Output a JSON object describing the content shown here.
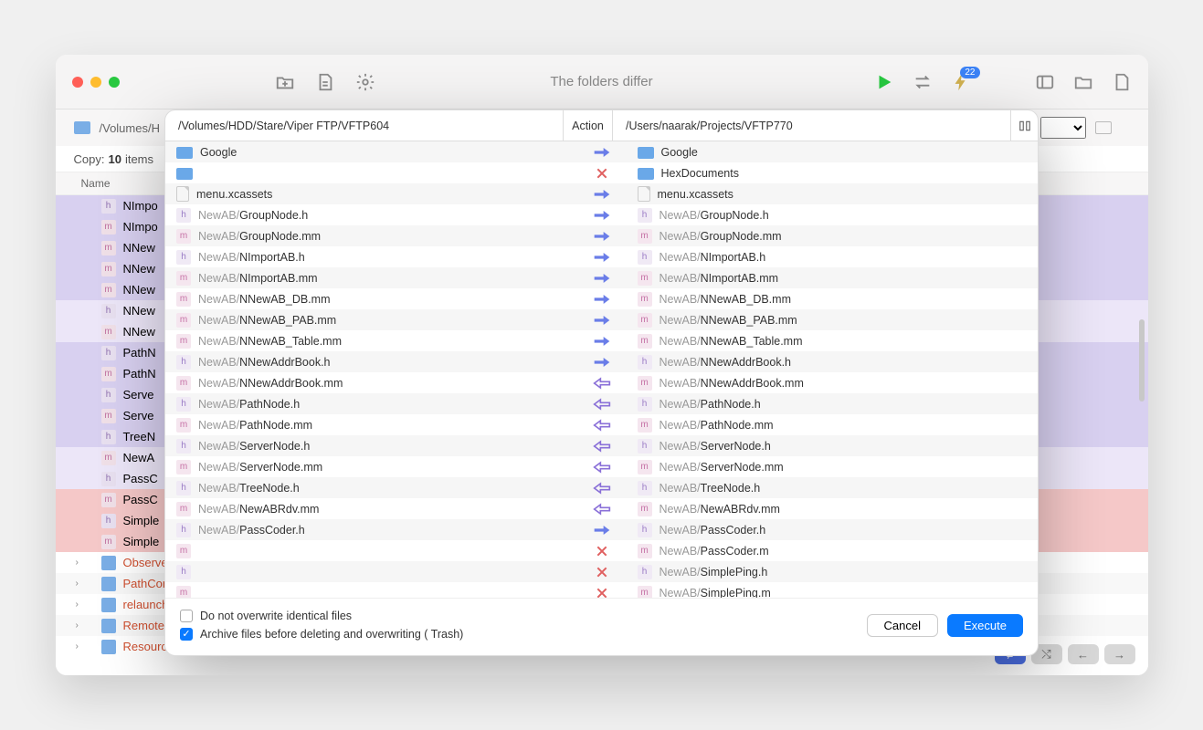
{
  "toolbar": {
    "title": "The folders differ",
    "badge": "22"
  },
  "bg": {
    "path": "/Volumes/H",
    "copy_prefix": "Copy:",
    "copy_count": "10",
    "copy_suffix": "items",
    "column_name": "Name",
    "rows": [
      {
        "icon": "h",
        "name": "NImpo",
        "cls": "row-purple"
      },
      {
        "icon": "m",
        "name": "NImpo",
        "cls": "row-purple"
      },
      {
        "icon": "m",
        "name": "NNew",
        "cls": "row-purple"
      },
      {
        "icon": "m",
        "name": "NNew",
        "cls": "row-purple"
      },
      {
        "icon": "m",
        "name": "NNew",
        "cls": "row-purple"
      },
      {
        "icon": "h",
        "name": "NNew",
        "cls": "row-lightpurple"
      },
      {
        "icon": "m",
        "name": "NNew",
        "cls": "row-lightpurple"
      },
      {
        "icon": "h",
        "name": "PathN",
        "cls": "row-purple"
      },
      {
        "icon": "m",
        "name": "PathN",
        "cls": "row-purple"
      },
      {
        "icon": "h",
        "name": "Serve",
        "cls": "row-purple"
      },
      {
        "icon": "m",
        "name": "Serve",
        "cls": "row-purple"
      },
      {
        "icon": "h",
        "name": "TreeN",
        "cls": "row-purple"
      },
      {
        "icon": "m",
        "name": "NewA",
        "cls": "row-lightpurple"
      },
      {
        "icon": "h",
        "name": "PassC",
        "cls": "row-lightpurple"
      },
      {
        "icon": "m",
        "name": "PassC",
        "cls": "row-pink"
      },
      {
        "icon": "h",
        "name": "Simple",
        "cls": "row-pink"
      },
      {
        "icon": "m",
        "name": "Simple",
        "cls": "row-pink"
      },
      {
        "icon": "folder",
        "name": "Observe",
        "cls": "",
        "red": true,
        "arrow": true
      },
      {
        "icon": "folder",
        "name": "PathCon",
        "cls": "row-lighter",
        "red": true,
        "arrow": true
      },
      {
        "icon": "folder",
        "name": "relaunch",
        "cls": "",
        "red": true,
        "arrow": true
      },
      {
        "icon": "folder",
        "name": "RemoteF",
        "cls": "row-lighter",
        "red": true,
        "arrow": true
      },
      {
        "icon": "folder",
        "name": "Resource",
        "cls": "",
        "red": true,
        "arrow": true
      }
    ]
  },
  "modal": {
    "left_path": "/Volumes/HDD/Stare/Viper FTP/VFTP604",
    "action_label": "Action",
    "right_path": "/Users/naarak/Projects/VFTP770",
    "rows": [
      {
        "li": "folder",
        "lprefix": "",
        "lname": "Google",
        "action": "right",
        "ri": "folder",
        "rprefix": "",
        "rname": "Google"
      },
      {
        "li": "folder",
        "lprefix": "",
        "lname": "",
        "action": "x",
        "ri": "folder",
        "rprefix": "",
        "rname": "HexDocuments"
      },
      {
        "li": "file",
        "lprefix": "",
        "lname": "menu.xcassets",
        "action": "right",
        "ri": "file",
        "rprefix": "",
        "rname": "menu.xcassets"
      },
      {
        "li": "h",
        "lprefix": "NewAB/",
        "lname": "GroupNode.h",
        "action": "right",
        "ri": "h",
        "rprefix": "NewAB/",
        "rname": "GroupNode.h"
      },
      {
        "li": "m",
        "lprefix": "NewAB/",
        "lname": "GroupNode.mm",
        "action": "right",
        "ri": "m",
        "rprefix": "NewAB/",
        "rname": "GroupNode.mm"
      },
      {
        "li": "h",
        "lprefix": "NewAB/",
        "lname": "NImportAB.h",
        "action": "right",
        "ri": "h",
        "rprefix": "NewAB/",
        "rname": "NImportAB.h"
      },
      {
        "li": "m",
        "lprefix": "NewAB/",
        "lname": "NImportAB.mm",
        "action": "right",
        "ri": "m",
        "rprefix": "NewAB/",
        "rname": "NImportAB.mm"
      },
      {
        "li": "m",
        "lprefix": "NewAB/",
        "lname": "NNewAB_DB.mm",
        "action": "right",
        "ri": "m",
        "rprefix": "NewAB/",
        "rname": "NNewAB_DB.mm"
      },
      {
        "li": "m",
        "lprefix": "NewAB/",
        "lname": "NNewAB_PAB.mm",
        "action": "right",
        "ri": "m",
        "rprefix": "NewAB/",
        "rname": "NNewAB_PAB.mm"
      },
      {
        "li": "m",
        "lprefix": "NewAB/",
        "lname": "NNewAB_Table.mm",
        "action": "right",
        "ri": "m",
        "rprefix": "NewAB/",
        "rname": "NNewAB_Table.mm"
      },
      {
        "li": "h",
        "lprefix": "NewAB/",
        "lname": "NNewAddrBook.h",
        "action": "right",
        "ri": "h",
        "rprefix": "NewAB/",
        "rname": "NNewAddrBook.h"
      },
      {
        "li": "m",
        "lprefix": "NewAB/",
        "lname": "NNewAddrBook.mm",
        "action": "left",
        "ri": "m",
        "rprefix": "NewAB/",
        "rname": "NNewAddrBook.mm"
      },
      {
        "li": "h",
        "lprefix": "NewAB/",
        "lname": "PathNode.h",
        "action": "left",
        "ri": "h",
        "rprefix": "NewAB/",
        "rname": "PathNode.h"
      },
      {
        "li": "m",
        "lprefix": "NewAB/",
        "lname": "PathNode.mm",
        "action": "left",
        "ri": "m",
        "rprefix": "NewAB/",
        "rname": "PathNode.mm"
      },
      {
        "li": "h",
        "lprefix": "NewAB/",
        "lname": "ServerNode.h",
        "action": "left",
        "ri": "h",
        "rprefix": "NewAB/",
        "rname": "ServerNode.h"
      },
      {
        "li": "m",
        "lprefix": "NewAB/",
        "lname": "ServerNode.mm",
        "action": "left",
        "ri": "m",
        "rprefix": "NewAB/",
        "rname": "ServerNode.mm"
      },
      {
        "li": "h",
        "lprefix": "NewAB/",
        "lname": "TreeNode.h",
        "action": "left",
        "ri": "h",
        "rprefix": "NewAB/",
        "rname": "TreeNode.h"
      },
      {
        "li": "m",
        "lprefix": "NewAB/",
        "lname": "NewABRdv.mm",
        "action": "left",
        "ri": "m",
        "rprefix": "NewAB/",
        "rname": "NewABRdv.mm"
      },
      {
        "li": "h",
        "lprefix": "NewAB/",
        "lname": "PassCoder.h",
        "action": "right",
        "ri": "h",
        "rprefix": "NewAB/",
        "rname": "PassCoder.h"
      },
      {
        "li": "m",
        "lprefix": "",
        "lname": "",
        "action": "x",
        "ri": "m",
        "rprefix": "NewAB/",
        "rname": "PassCoder.m"
      },
      {
        "li": "h",
        "lprefix": "",
        "lname": "",
        "action": "x",
        "ri": "h",
        "rprefix": "NewAB/",
        "rname": "SimplePing.h"
      },
      {
        "li": "m",
        "lprefix": "",
        "lname": "",
        "action": "x",
        "ri": "m",
        "rprefix": "NewAB/",
        "rname": "SimplePing.m"
      }
    ],
    "check1": "Do not overwrite identical files",
    "check2": "Archive files before deleting and overwriting ( Trash)",
    "cancel": "Cancel",
    "execute": "Execute"
  }
}
